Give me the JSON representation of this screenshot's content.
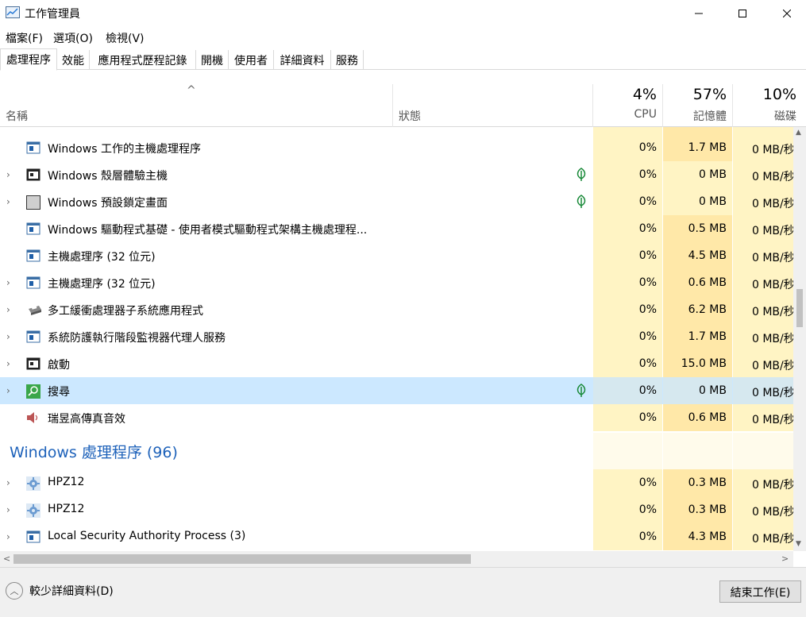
{
  "window": {
    "title": "工作管理員"
  },
  "menu": [
    "檔案(F)",
    "選項(O)",
    "檢視(V)"
  ],
  "tabs": [
    "處理程序",
    "效能",
    "應用程式歷程記錄",
    "開機",
    "使用者",
    "詳細資料",
    "服務"
  ],
  "header": {
    "sort_caret": "^",
    "name": "名稱",
    "status": "狀態",
    "cpu_pct": "4%",
    "cpu_label": "CPU",
    "mem_pct": "57%",
    "mem_label": "記憶體",
    "disk_pct": "10%",
    "disk_label": "磁碟"
  },
  "rows": [
    {
      "name": "Windows 工作的主機處理程序",
      "cpu": "0%",
      "mem": "1.7 MB",
      "disk": "0 MB/秒",
      "expandable": false,
      "leaf": false,
      "icon": "window-icon"
    },
    {
      "name": "Windows 殼層體驗主機",
      "cpu": "0%",
      "mem": "0 MB",
      "disk": "0 MB/秒",
      "expandable": true,
      "leaf": true,
      "icon": "app-frame-icon"
    },
    {
      "name": "Windows 預設鎖定畫面",
      "cpu": "0%",
      "mem": "0 MB",
      "disk": "0 MB/秒",
      "expandable": true,
      "leaf": true,
      "icon": "gray-square-icon"
    },
    {
      "name": "Windows 驅動程式基礎 - 使用者模式驅動程式架構主機處理程...",
      "cpu": "0%",
      "mem": "0.5 MB",
      "disk": "0 MB/秒",
      "expandable": false,
      "leaf": false,
      "icon": "window-icon"
    },
    {
      "name": "主機處理序 (32 位元)",
      "cpu": "0%",
      "mem": "4.5 MB",
      "disk": "0 MB/秒",
      "expandable": false,
      "leaf": false,
      "icon": "window-icon"
    },
    {
      "name": "主機處理序 (32 位元)",
      "cpu": "0%",
      "mem": "0.6 MB",
      "disk": "0 MB/秒",
      "expandable": true,
      "leaf": false,
      "icon": "window-icon"
    },
    {
      "name": "多工緩衝處理器子系統應用程式",
      "cpu": "0%",
      "mem": "6.2 MB",
      "disk": "0 MB/秒",
      "expandable": true,
      "leaf": false,
      "icon": "printer-icon"
    },
    {
      "name": "系統防護執行階段監視器代理人服務",
      "cpu": "0%",
      "mem": "1.7 MB",
      "disk": "0 MB/秒",
      "expandable": true,
      "leaf": false,
      "icon": "window-icon"
    },
    {
      "name": "啟動",
      "cpu": "0%",
      "mem": "15.0 MB",
      "disk": "0 MB/秒",
      "expandable": true,
      "leaf": false,
      "icon": "app-frame-icon"
    },
    {
      "name": "搜尋",
      "cpu": "0%",
      "mem": "0 MB",
      "disk": "0 MB/秒",
      "expandable": true,
      "leaf": true,
      "icon": "search-icon",
      "selected": true
    },
    {
      "name": "瑞昱高傳真音效",
      "cpu": "0%",
      "mem": "0.6 MB",
      "disk": "0 MB/秒",
      "expandable": false,
      "leaf": false,
      "icon": "speaker-icon"
    }
  ],
  "group": {
    "title": "Windows 處理程序 (96)"
  },
  "rows2": [
    {
      "name": "HPZ12",
      "cpu": "0%",
      "mem": "0.3 MB",
      "disk": "0 MB/秒",
      "expandable": true,
      "icon": "gear-icon"
    },
    {
      "name": "HPZ12",
      "cpu": "0%",
      "mem": "0.3 MB",
      "disk": "0 MB/秒",
      "expandable": true,
      "icon": "gear-icon"
    },
    {
      "name": "Local Security Authority Process (3)",
      "cpu": "0%",
      "mem": "4.3 MB",
      "disk": "0 MB/秒",
      "expandable": true,
      "icon": "window-icon"
    }
  ],
  "footer": {
    "fewer_details": "較少詳細資料(D)",
    "end_task": "結束工作(E)"
  },
  "colors": {
    "selected_row": "#cce8ff",
    "heat_light": "#fff4c4",
    "heat_mid": "#ffe8a8",
    "group_title": "#1e62ba"
  }
}
